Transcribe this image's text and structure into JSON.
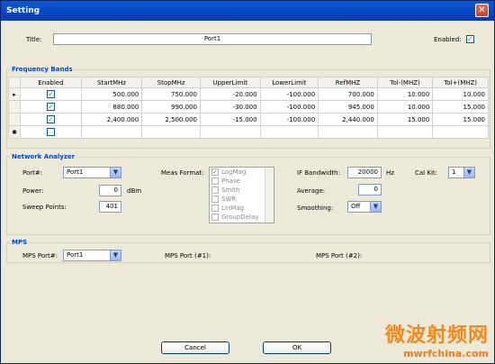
{
  "window": {
    "title": "Setting",
    "close_glyph": "✕"
  },
  "top": {
    "title_label": "Title:",
    "title_value": "Port1",
    "enabled_label": "Enabled:",
    "enabled_checked": true
  },
  "freq_bands": {
    "group_title": "Frequency Bands",
    "columns": [
      "Enabled",
      "StartMHz",
      "StopMHz",
      "UpperLimit",
      "LowerLimit",
      "RefMHZ",
      "Tol-(MHZ)",
      "Tol+(MHZ)"
    ],
    "rows": [
      {
        "indicator": "▸",
        "enabled": true,
        "start": "500.000",
        "stop": "750.000",
        "upper": "-20.000",
        "lower": "-100.000",
        "ref": "700.000",
        "tol_minus": "10.000",
        "tol_plus": "10.000"
      },
      {
        "indicator": "",
        "enabled": true,
        "start": "880.000",
        "stop": "990.000",
        "upper": "-30.000",
        "lower": "-100.000",
        "ref": "945.000",
        "tol_minus": "10.000",
        "tol_plus": "15.000"
      },
      {
        "indicator": "",
        "enabled": true,
        "start": "2,400.000",
        "stop": "2,500.000",
        "upper": "-15.000",
        "lower": "-100.000",
        "ref": "2,440.000",
        "tol_minus": "15.000",
        "tol_plus": "15.000"
      }
    ],
    "new_row_indicator": "✱"
  },
  "network": {
    "group_title": "Network Analyzer",
    "port_label": "Port#:",
    "port_value": "Port1",
    "power_label": "Power:",
    "power_value": "0",
    "power_unit": "dBm",
    "sweep_label": "Sweep Points:",
    "sweep_value": "401",
    "meas_label": "Meas Format:",
    "meas_options": [
      {
        "label": "LogMag",
        "checked": true
      },
      {
        "label": "Phase",
        "checked": false
      },
      {
        "label": "Smith",
        "checked": false
      },
      {
        "label": "SWR",
        "checked": false
      },
      {
        "label": "LinMag",
        "checked": false
      },
      {
        "label": "GroupDelay",
        "checked": false
      }
    ],
    "if_label": "IF Bandwidth:",
    "if_value": "20000",
    "if_unit": "Hz",
    "calkit_label": "Cal Kit:",
    "calkit_value": "1",
    "average_label": "Average:",
    "average_value": "0",
    "smoothing_label": "Smoothing:",
    "smoothing_value": "Off"
  },
  "mps": {
    "group_title": "MPS",
    "port_label": "MPS Port#:",
    "port_value": "Port1",
    "port1_label": "MPS Port (#1):",
    "port2_label": "MPS Port (#2):"
  },
  "buttons": {
    "cancel": "Cancel",
    "ok": "OK"
  },
  "watermark": {
    "cn": "微波射频网",
    "url": "mwrfchina.com"
  }
}
